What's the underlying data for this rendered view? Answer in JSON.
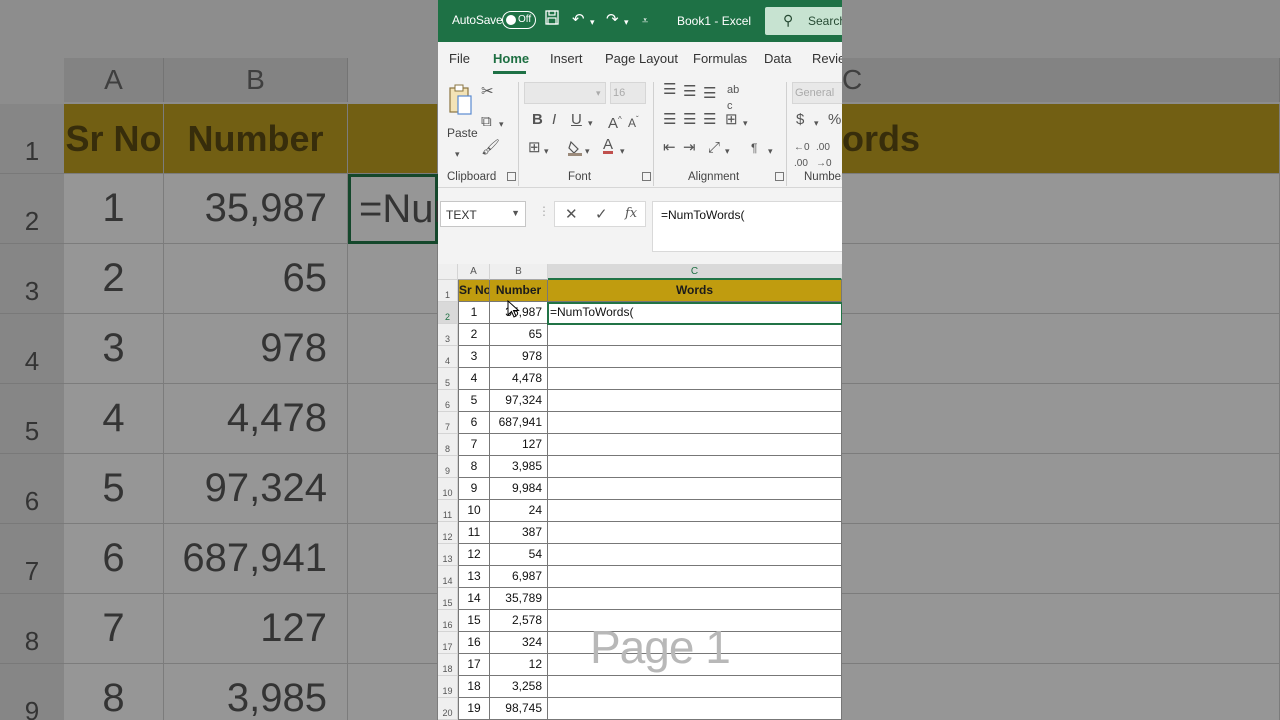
{
  "background": {
    "col_headers": [
      "A",
      "B",
      "C"
    ],
    "header_row": {
      "row": "1",
      "sr_no": "Sr No",
      "number": "Number",
      "words_partial": "ords"
    },
    "rows": [
      {
        "row": "2",
        "sr": "1",
        "num": "35,987",
        "formula": "=Nur"
      },
      {
        "row": "3",
        "sr": "2",
        "num": "65"
      },
      {
        "row": "4",
        "sr": "3",
        "num": "978"
      },
      {
        "row": "5",
        "sr": "4",
        "num": "4,478"
      },
      {
        "row": "6",
        "sr": "5",
        "num": "97,324"
      },
      {
        "row": "7",
        "sr": "6",
        "num": "687,941"
      },
      {
        "row": "8",
        "sr": "7",
        "num": "127"
      },
      {
        "row": "9",
        "sr": "8",
        "num": "3,985"
      }
    ]
  },
  "titlebar": {
    "autosave_label": "AutoSave",
    "toggle_label": "Off",
    "book_title": "Book1 - Excel",
    "search_label": "Search"
  },
  "tabs": [
    "File",
    "Home",
    "Insert",
    "Page Layout",
    "Formulas",
    "Data",
    "Review"
  ],
  "ribbon": {
    "paste_label": "Paste",
    "font_size": "16",
    "number_format": "General",
    "groups": [
      "Clipboard",
      "Font",
      "Alignment",
      "Number"
    ]
  },
  "formula_bar": {
    "name_box": "TEXT",
    "formula": "=NumToWords("
  },
  "sheet": {
    "columns": [
      "A",
      "B",
      "C"
    ],
    "header": {
      "sr_no": "Sr No",
      "number": "Number",
      "words": "Words"
    },
    "active_cell_text": "=NumToWords(",
    "rows": [
      {
        "row": "2",
        "sr": "1",
        "num": "35,987"
      },
      {
        "row": "3",
        "sr": "2",
        "num": "65"
      },
      {
        "row": "4",
        "sr": "3",
        "num": "978"
      },
      {
        "row": "5",
        "sr": "4",
        "num": "4,478"
      },
      {
        "row": "6",
        "sr": "5",
        "num": "97,324"
      },
      {
        "row": "7",
        "sr": "6",
        "num": "687,941"
      },
      {
        "row": "8",
        "sr": "7",
        "num": "127"
      },
      {
        "row": "9",
        "sr": "8",
        "num": "3,985"
      },
      {
        "row": "10",
        "sr": "9",
        "num": "9,984"
      },
      {
        "row": "11",
        "sr": "10",
        "num": "24"
      },
      {
        "row": "12",
        "sr": "11",
        "num": "387"
      },
      {
        "row": "13",
        "sr": "12",
        "num": "54"
      },
      {
        "row": "14",
        "sr": "13",
        "num": "6,987"
      },
      {
        "row": "15",
        "sr": "14",
        "num": "35,789"
      },
      {
        "row": "16",
        "sr": "15",
        "num": "2,578"
      },
      {
        "row": "17",
        "sr": "16",
        "num": "324"
      },
      {
        "row": "18",
        "sr": "17",
        "num": "12"
      },
      {
        "row": "19",
        "sr": "18",
        "num": "3,258"
      },
      {
        "row": "20",
        "sr": "19",
        "num": "98,745"
      }
    ],
    "watermark": "Page 1"
  },
  "colors": {
    "excel_green": "#1e7145",
    "header_gold": "#c09c0f"
  }
}
